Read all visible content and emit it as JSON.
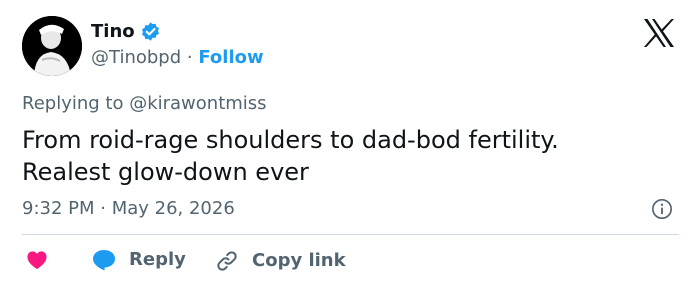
{
  "author": {
    "display_name": "Tino",
    "handle": "@Tinobpd",
    "separator": "·",
    "follow_label": "Follow"
  },
  "replying_to": "Replying to @kirawontmiss",
  "tweet": {
    "lines": [
      "From roid-rage shoulders to dad-bod fertility.",
      "Realest glow-down ever"
    ]
  },
  "timestamp": "9:32 PM · May 26, 2026",
  "actions": {
    "reply_label": "Reply",
    "copy_link_label": "Copy link"
  },
  "icons": {
    "verified": "verified-badge-icon",
    "logo": "x-logo-icon",
    "info": "info-icon",
    "like": "heart-icon",
    "reply": "chat-bubble-icon",
    "copy": "link-icon"
  },
  "colors": {
    "accent": "#1d9bf0",
    "like": "#f91880",
    "text": "#0f1419",
    "muted": "#536471"
  }
}
